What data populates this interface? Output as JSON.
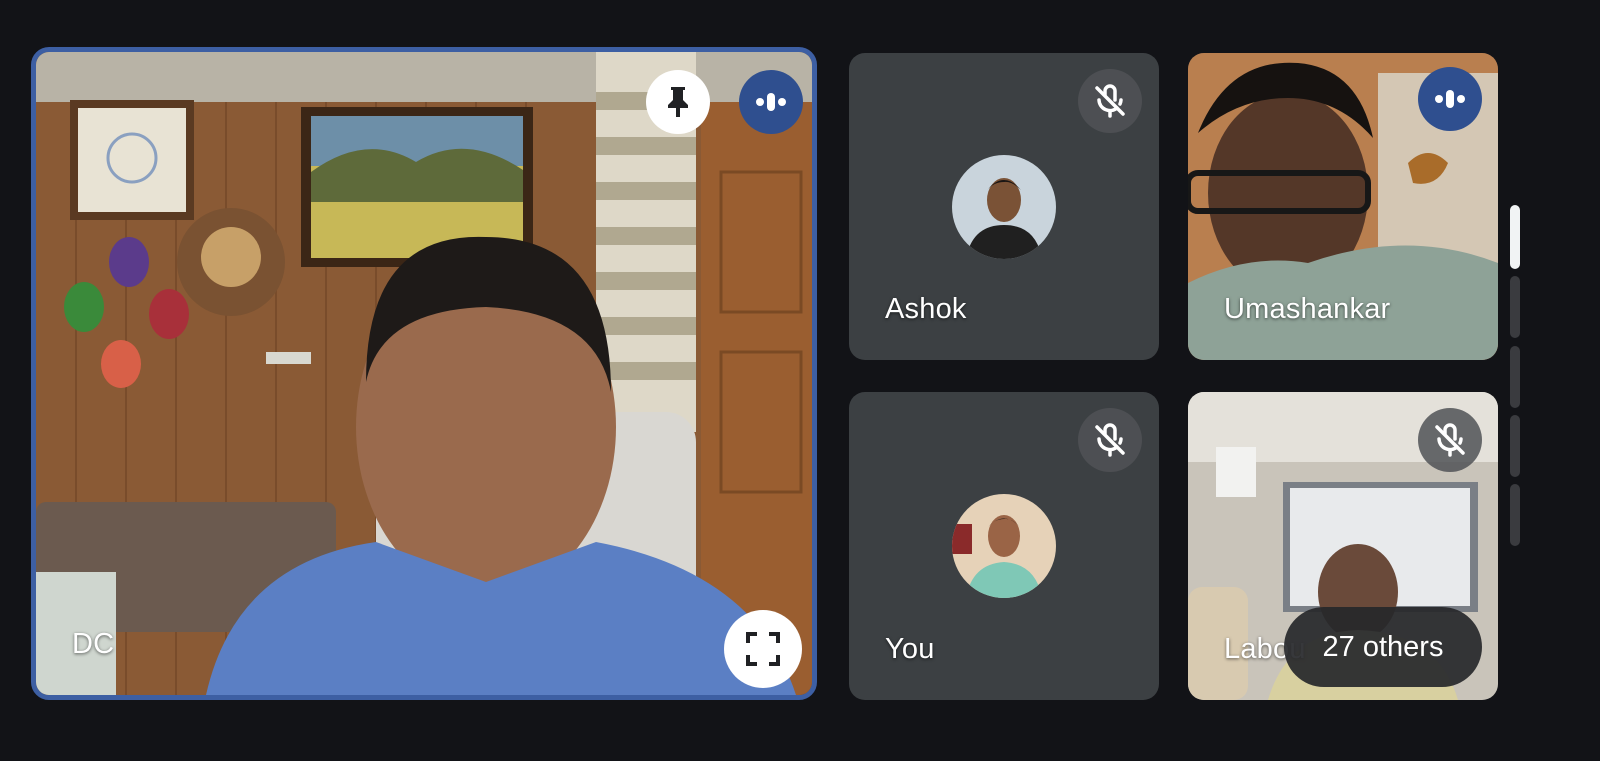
{
  "main_tile": {
    "name": "DC"
  },
  "tiles": [
    {
      "name": "Ashok"
    },
    {
      "name": "Umashankar"
    },
    {
      "name": "You"
    },
    {
      "name": "Labou"
    }
  ],
  "others_chip": {
    "label": "27 others"
  },
  "colors": {
    "background": "#121317",
    "tile": "#3c4043",
    "active_border": "#3d5fa3",
    "speaking_indicator": "#2f4f8f"
  },
  "icons": [
    "pin-icon",
    "speaking-indicator-icon",
    "fullscreen-icon",
    "mic-off-icon"
  ]
}
